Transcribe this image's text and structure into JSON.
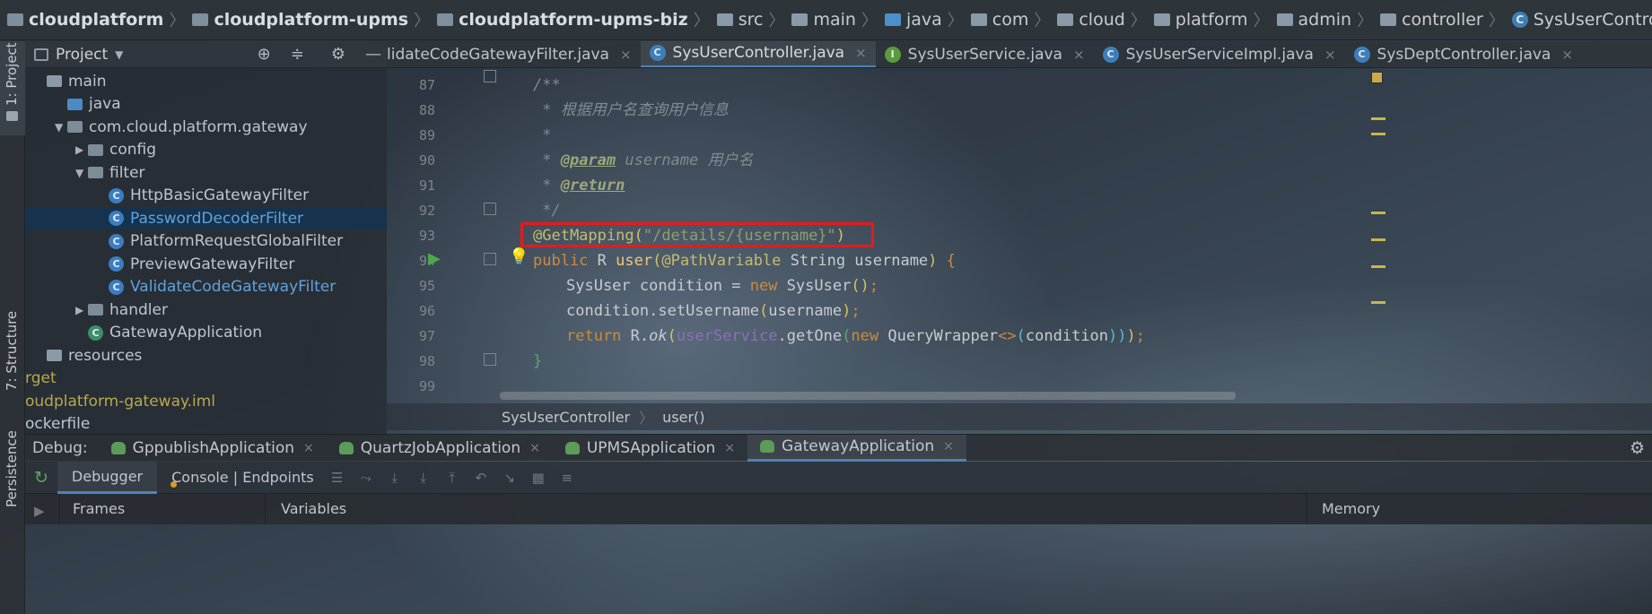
{
  "breadcrumb": [
    "cloudplatform",
    "cloudplatform-upms",
    "cloudplatform-upms-biz",
    "src",
    "main",
    "java",
    "com",
    "cloud",
    "platform",
    "admin",
    "controller",
    "SysUserController"
  ],
  "left_strip": {
    "project": "1: Project",
    "structure": "7: Structure",
    "persistence": "Persistence"
  },
  "project": {
    "title": "Project",
    "tree": [
      {
        "label": "main",
        "depth": 0,
        "icon": "folder-icon",
        "arrow": ""
      },
      {
        "label": "java",
        "depth": 1,
        "icon": "folder-blue-icon",
        "arrow": ""
      },
      {
        "label": "com.cloud.platform.gateway",
        "depth": 1,
        "icon": "package-icon",
        "arrow": "▼"
      },
      {
        "label": "config",
        "depth": 2,
        "icon": "package-icon",
        "arrow": "▶"
      },
      {
        "label": "filter",
        "depth": 2,
        "icon": "package-icon",
        "arrow": "▼"
      },
      {
        "label": "HttpBasicGatewayFilter",
        "depth": 3,
        "icon": "class-icon",
        "arrow": ""
      },
      {
        "label": "PasswordDecoderFilter",
        "depth": 3,
        "icon": "class-icon",
        "arrow": "",
        "selected": true
      },
      {
        "label": "PlatformRequestGlobalFilter",
        "depth": 3,
        "icon": "class-icon",
        "arrow": ""
      },
      {
        "label": "PreviewGatewayFilter",
        "depth": 3,
        "icon": "class-icon",
        "arrow": ""
      },
      {
        "label": "ValidateCodeGatewayFilter",
        "depth": 3,
        "icon": "class-icon",
        "arrow": "",
        "blue": true
      },
      {
        "label": "handler",
        "depth": 2,
        "icon": "package-icon",
        "arrow": "▶"
      },
      {
        "label": "GatewayApplication",
        "depth": 2,
        "icon": "app-icon",
        "arrow": ""
      },
      {
        "label": "resources",
        "depth": 0,
        "icon": "resources-icon",
        "arrow": ""
      },
      {
        "label": "rget",
        "depth": -1,
        "icon": "",
        "arrow": "",
        "olive": true
      },
      {
        "label": "oudplatform-gateway.iml",
        "depth": -1,
        "icon": "",
        "arrow": "",
        "olive": true
      },
      {
        "label": "ockerfile",
        "depth": -1,
        "icon": "",
        "arrow": ""
      }
    ]
  },
  "editor_tabs": [
    {
      "label": "lidateCodeGatewayFilter.java",
      "icon": "",
      "active": false
    },
    {
      "label": "SysUserController.java",
      "icon": "C",
      "active": true
    },
    {
      "label": "SysUserService.java",
      "icon": "I",
      "active": false
    },
    {
      "label": "SysUserServiceImpl.java",
      "icon": "C",
      "active": false
    },
    {
      "label": "SysDeptController.java",
      "icon": "C",
      "active": false
    }
  ],
  "code": {
    "line_numbers": [
      "87",
      "88",
      "89",
      "90",
      "91",
      "92",
      "93",
      "94",
      "95",
      "96",
      "97",
      "98",
      "99"
    ],
    "comment_open": "/**",
    "comment_desc": " * 根据用户名查询用户信息",
    "comment_star": " *",
    "param_prefix": " * ",
    "param_tag": "@param",
    "param_rest": " username 用户名",
    "return_prefix": " * ",
    "return_tag": "@return",
    "comment_close": " */",
    "mapping_ann": "@GetMapping",
    "mapping_open": "(",
    "mapping_str": "\"/details/{username}\"",
    "mapping_close": ")",
    "sig_public": "public",
    "sig_type": " R ",
    "sig_name": "user",
    "sig_open": "(",
    "sig_ann": "@PathVariable",
    "sig_rest": " String username",
    "sig_close": ")",
    "sig_brace": " {",
    "l95_a": "SysUser condition = ",
    "l95_new": "new",
    "l95_b": " SysUser",
    "l95_c": "()",
    "l95_d": ";",
    "l96_a": "condition",
    "l96_b": ".setUsername",
    "l96_c": "(",
    "l96_d": "username",
    "l96_e": ")",
    "l96_f": ";",
    "l97_return": "return",
    "l97_a": " R",
    "l97_b": ".",
    "l97_ok": "ok",
    "l97_c": "(",
    "l97_svc": "userService",
    "l97_d": ".getOne",
    "l97_e": "(",
    "l97_new": "new",
    "l97_f": " QueryWrapper",
    "l97_g": "<>",
    "l97_h": "(",
    "l97_i": "condition",
    "l97_j": "))",
    "l97_k": ")",
    "l97_l": ";",
    "close_brace": "}"
  },
  "code_breadcrumb": {
    "class": "SysUserController",
    "method": "user()"
  },
  "debug": {
    "label": "Debug:",
    "tabs": [
      {
        "label": "GppublishApplication",
        "active": false
      },
      {
        "label": "QuartzJobApplication",
        "active": false
      },
      {
        "label": "UPMSApplication",
        "active": false
      },
      {
        "label": "GatewayApplication",
        "active": true
      }
    ],
    "debugger_tab": "Debugger",
    "console_tab": "Console | Endpoints",
    "frames": "Frames",
    "variables": "Variables",
    "memory": "Memory"
  },
  "colors": {
    "selection_box": "#e81a1a",
    "accent": "#4c83b8"
  }
}
